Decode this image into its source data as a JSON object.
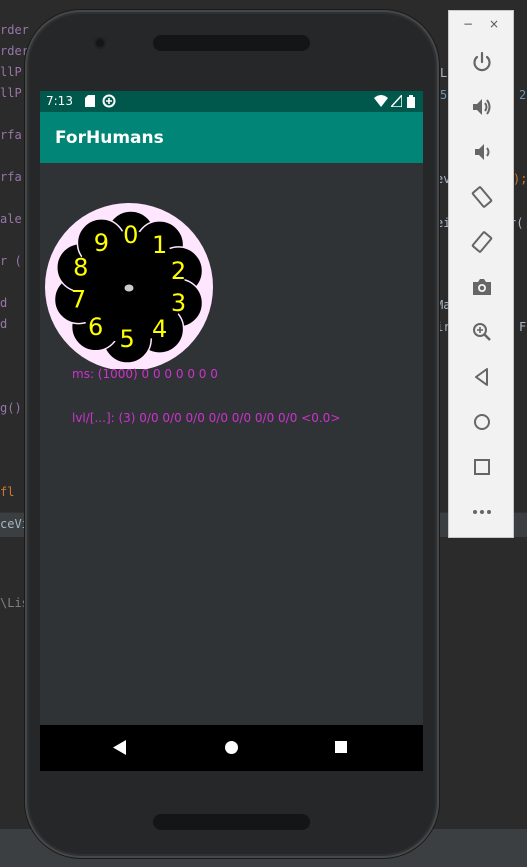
{
  "ide": {
    "code_fragments": [
      "rder",
      "rder",
      "llP",
      "llP",
      "",
      "rfa",
      "",
      "rfa",
      "",
      "ale",
      "",
      "r (",
      "",
      "d",
      "d",
      "",
      "",
      "",
      "g()",
      "",
      "",
      "",
      "  fl"
    ],
    "right_fragments": [
      "L",
      "5",
      "2",
      "ev",
      ");",
      "ei",
      "r(",
      "Ma",
      "ir",
      "F"
    ],
    "bottom_tab": "ceVi",
    "panel_text": "\\Lis"
  },
  "phone": {
    "status_time": "7:13",
    "app_title": "ForHumans",
    "dial": {
      "numbers": [
        "0",
        "1",
        "2",
        "3",
        "4",
        "5",
        "6",
        "7",
        "8",
        "9"
      ],
      "ring_color": "#ffe6ff",
      "hole_color": "#000000",
      "number_color": "#ffff00"
    },
    "info": {
      "ms_line": "ms: (1000) 0 0 0 0 0 0 0",
      "lvl_line": "lvl/[...]: (3) 0/0 0/0 0/0 0/0 0/0 0/0 0/0  <0.0>"
    },
    "colors": {
      "status_bar": "#00574b",
      "app_bar": "#008577",
      "info_text": "#cc33cc"
    }
  },
  "toolbar": {
    "minimize": "−",
    "close": "×",
    "buttons": [
      "power-icon",
      "volume-up-icon",
      "volume-down-icon",
      "rotate-left-icon",
      "rotate-right-icon",
      "camera-icon",
      "zoom-icon",
      "back-icon",
      "home-icon",
      "overview-icon",
      "more-icon"
    ]
  }
}
